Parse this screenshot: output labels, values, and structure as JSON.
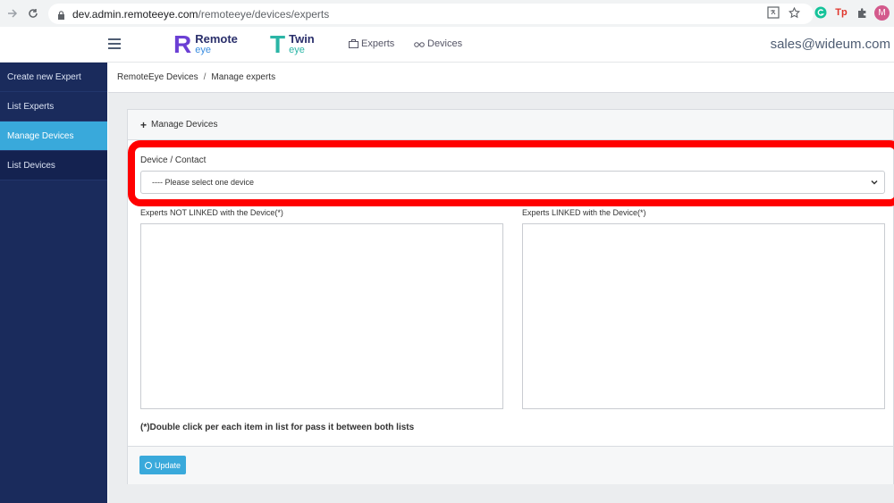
{
  "browser": {
    "url_host": "dev.admin.remoteeye.com",
    "url_path": "/remoteeye/devices/experts",
    "extensions": [
      "translate-icon",
      "star-icon",
      "grammarly-icon",
      "tp-icon",
      "puzzle-icon"
    ],
    "tp_label": "Tp",
    "profile_initial": "M"
  },
  "header": {
    "brand1": {
      "letter": "R",
      "title": "Remote",
      "sub": "eye"
    },
    "brand2": {
      "letter": "T",
      "title": "Twin",
      "sub": "eye"
    },
    "nav": [
      {
        "label": "Experts"
      },
      {
        "label": "Devices"
      }
    ],
    "account": "sales@wideum.com"
  },
  "sidebar": {
    "items": [
      {
        "label": "Create new Expert"
      },
      {
        "label": "List Experts"
      },
      {
        "label": "Manage Devices"
      },
      {
        "label": "List Devices"
      }
    ]
  },
  "breadcrumb": {
    "root": "RemoteEye Devices",
    "separator": "/",
    "current": "Manage experts"
  },
  "card": {
    "header": "Manage Devices",
    "device_label": "Device / Contact",
    "device_select_value": "---- Please select one device",
    "not_linked_label": "Experts NOT LINKED with the Device(*)",
    "linked_label": "Experts LINKED with the Device(*)",
    "hint": "(*)Double click per each item in list for pass it between both lists",
    "update_button": "Update"
  },
  "colors": {
    "sidebar_bg": "#1a2b5c",
    "active": "#39a9db",
    "highlight": "#ff0000"
  }
}
